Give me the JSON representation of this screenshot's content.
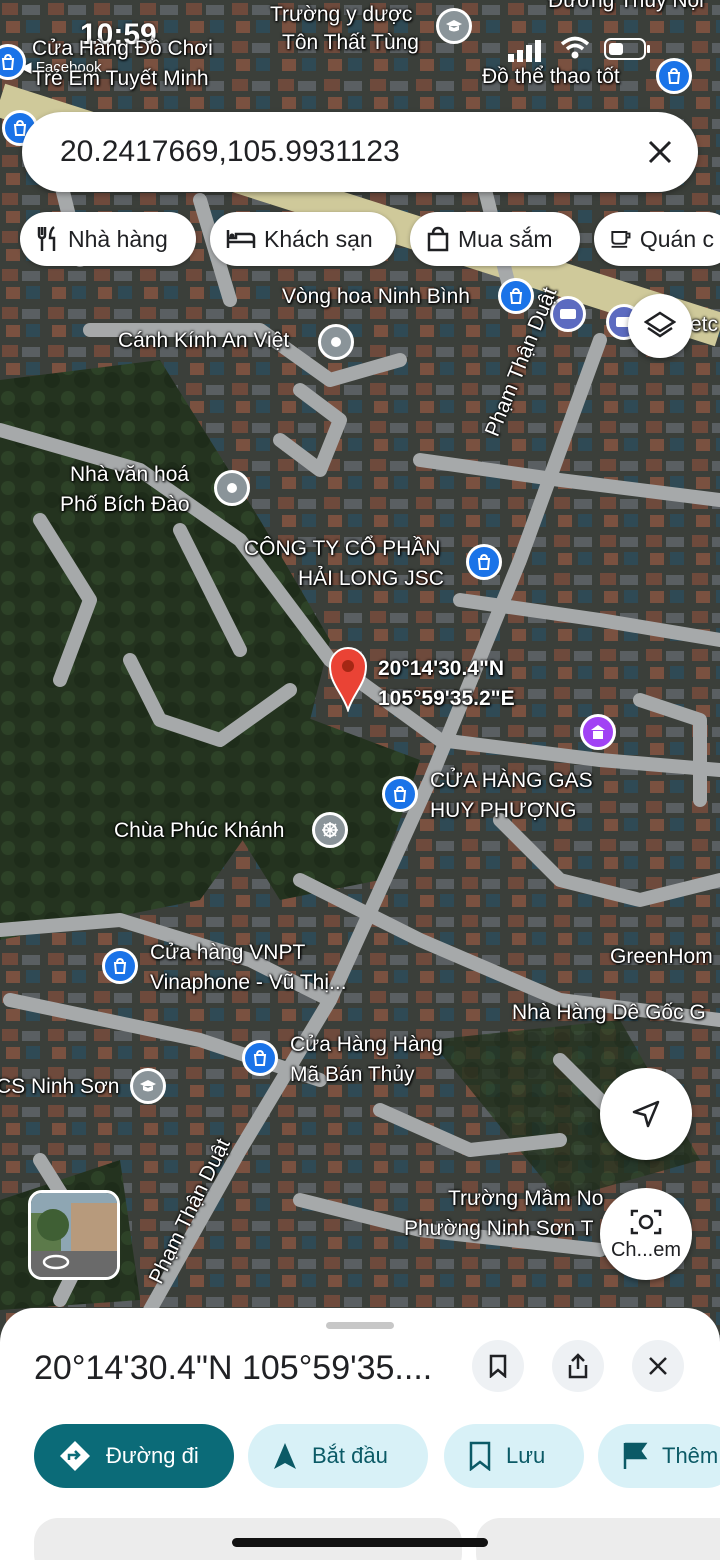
{
  "status": {
    "time": "10:59",
    "back_label": "◀ Facebook"
  },
  "search": {
    "query": "20.2417669,105.9931123"
  },
  "chips": [
    {
      "label": "Nhà hàng",
      "icon": "fork-knife-icon"
    },
    {
      "label": "Khách sạn",
      "icon": "bed-icon"
    },
    {
      "label": "Mua sắm",
      "icon": "shopping-bag-icon"
    },
    {
      "label": "Quán c",
      "icon": "coffee-icon"
    }
  ],
  "map": {
    "pin_coords_line1": "20°14'30.4\"N",
    "pin_coords_line2": "105°59'35.2\"E",
    "labels": {
      "toy_store_1": "Cửa Hàng Đồ Chơi",
      "toy_store_2": "Trẻ Em Tuyết Minh",
      "medical_school_1": "Trường y dược",
      "medical_school_2": "Tôn Thất Tùng",
      "sports": "Đồ thể thao tốt",
      "top_road": "Đường Thủy Nội",
      "wreath": "Vòng hoa Ninh Bình",
      "glass": "Cánh Kính An Việt",
      "culture_house_1": "Nhà văn hoá",
      "culture_house_2": "Phố Bích Đào",
      "company_1": "CÔNG TY CỔ PHẦN",
      "company_2": "HẢI LONG JSC",
      "gas_1": "CỬA HÀNG GAS",
      "gas_2": "HUY PHƯỢNG",
      "pagoda": "Chùa Phúc Khánh",
      "vnpt_1": "Cửa hàng VNPT",
      "vnpt_2": "Vinaphone - Vũ Thị...",
      "greenhome": "GreenHom",
      "goat_restaurant": "Nhà Hàng Dê Gốc G",
      "mabian_1": "Cửa Hàng Hàng",
      "mabian_2": "Mã Bán Thủy",
      "school_left": "CS Ninh Sơn",
      "kindergarten_1": "Trường Mầm No",
      "kindergarten_2": "Phường Ninh Sơn T",
      "road_1": "Phạm Thận Duật",
      "road_2": "Phạm Thận Duật",
      "etc": "etc"
    }
  },
  "camera_button": {
    "label": "Ch...em"
  },
  "sheet": {
    "title": "20°14'30.4\"N 105°59'35....",
    "actions": [
      {
        "label": "Đường đi",
        "icon": "directions-icon"
      },
      {
        "label": "Bắt đầu",
        "icon": "navigation-arrow-icon"
      },
      {
        "label": "Lưu",
        "icon": "bookmark-icon"
      },
      {
        "label": "Thêm",
        "icon": "flag-icon"
      }
    ]
  },
  "colors": {
    "accent": "#0b6b78",
    "pin": "#ea4335",
    "poi": "#1a73e8"
  }
}
